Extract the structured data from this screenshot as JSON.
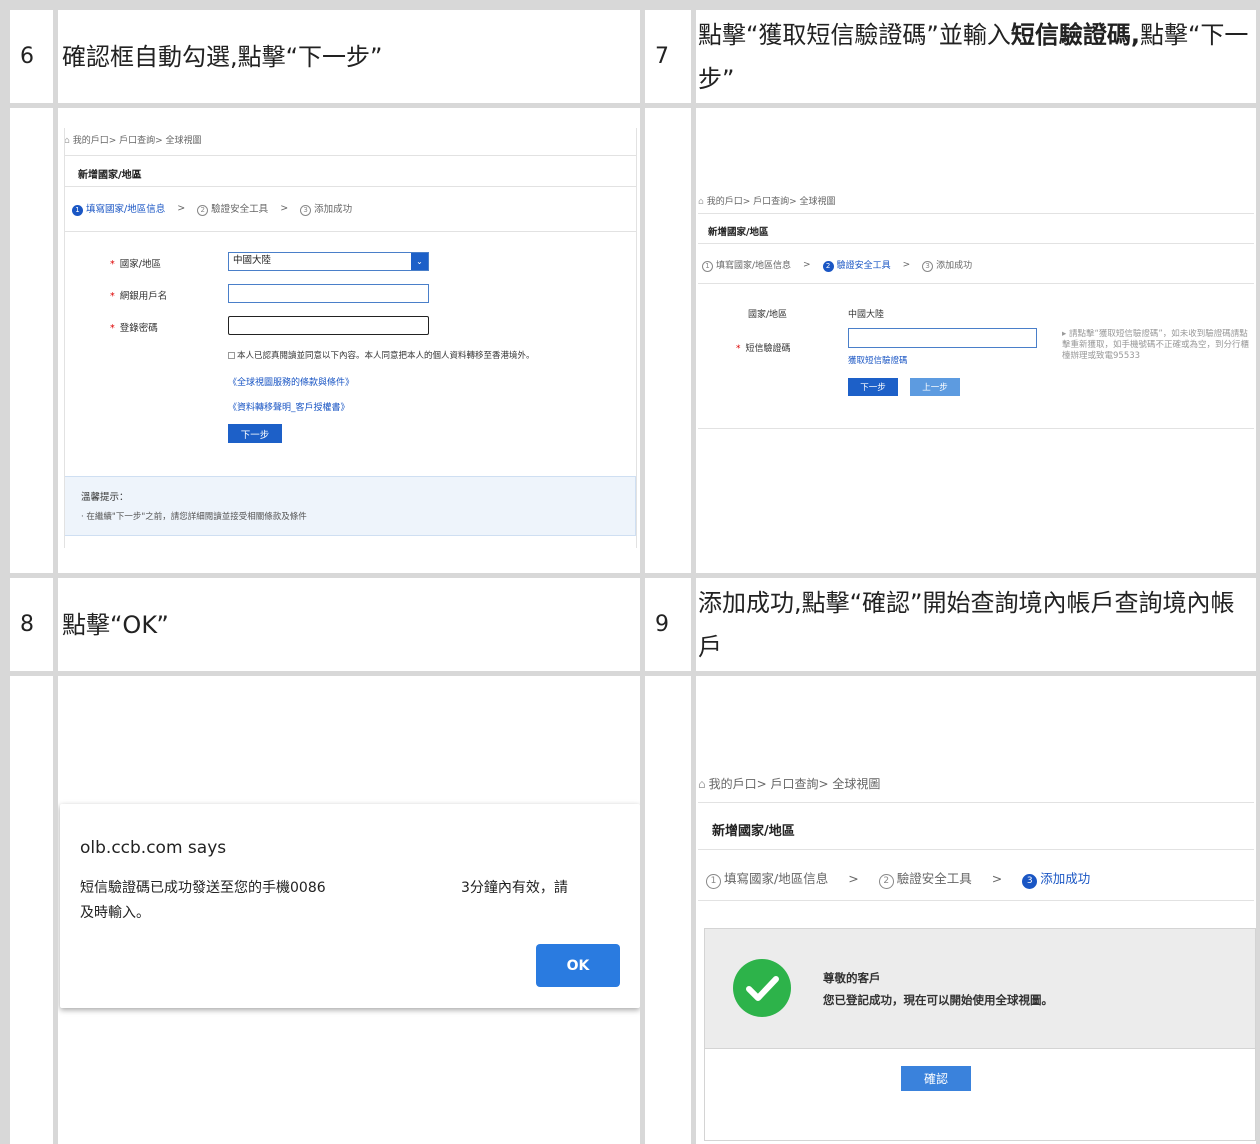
{
  "rows": [
    {
      "left_num": "6",
      "left_text": "確認框自動勾選,點擊“下一步”",
      "right_num": "7",
      "right_parts": [
        "點擊“獲取短信驗證碼”並輸入",
        "短信驗證碼,",
        "點擊“下一步”"
      ]
    },
    {
      "left_num": "8",
      "left_text": "點擊“OK”",
      "right_num": "9",
      "right_parts": [
        "添加成功,點擊“確認”開始查詢境內帳戶查詢境內帳戶"
      ]
    }
  ],
  "shot6": {
    "breadcrumb": "我的戶口> 戶口查詢> 全球視圖",
    "title": "新增國家/地區",
    "steps": [
      "填寫國家/地區信息",
      "驗證安全工具",
      "添加成功"
    ],
    "step_nums": [
      "1",
      "2",
      "3"
    ],
    "labels": [
      "國家/地區",
      "網銀用戶名",
      "登錄密碼"
    ],
    "country_value": "中國大陸",
    "consent": "本人已認真閱讀並同意以下內容。本人同意把本人的個人資料轉移至香港境外。",
    "link1": "《全球視圖服務的條款與條件》",
    "link2": "《資料轉移聲明_客戶授權書》",
    "next_btn": "下一步",
    "tip_title": "溫馨提示：",
    "tip_text": "· 在繼續\"下一步\"之前，請您詳細閱讀並接受相關條款及條件"
  },
  "shot7": {
    "breadcrumb": "我的戶口> 戶口查詢> 全球視圖",
    "title": "新增國家/地區",
    "steps": [
      "填寫國家/地區信息",
      "驗證安全工具",
      "添加成功"
    ],
    "step_nums": [
      "1",
      "2",
      "3"
    ],
    "country_label": "國家/地區",
    "country_value": "中國大陸",
    "sms_label": "短信驗證碼",
    "get_sms": "獲取短信驗證碼",
    "next_btn": "下一步",
    "prev_btn": "上一步",
    "note": "請點擊“獲取短信驗證碼”，如未收到驗證碼請點擊重新獲取，如手機號碼不正確或為空，到分行櫃檯辦理或致電95533"
  },
  "shot8": {
    "dialog_title": "olb.ccb.com says",
    "message_a": "短信驗證碼已成功發送至您的手機0086",
    "message_b": "3分鐘內有效，請",
    "message_c": "及時輸入。",
    "ok_btn": "OK"
  },
  "shot9": {
    "breadcrumb": "我的戶口> 戶口查詢> 全球視圖",
    "title": "新增國家/地區",
    "steps": [
      "填寫國家/地區信息",
      "驗證安全工具",
      "添加成功"
    ],
    "step_nums": [
      "1",
      "2",
      "3"
    ],
    "success_title": "尊敬的客戶",
    "success_text": "您已登記成功，現在可以開始使用全球視圖。",
    "confirm_btn": "確認"
  }
}
